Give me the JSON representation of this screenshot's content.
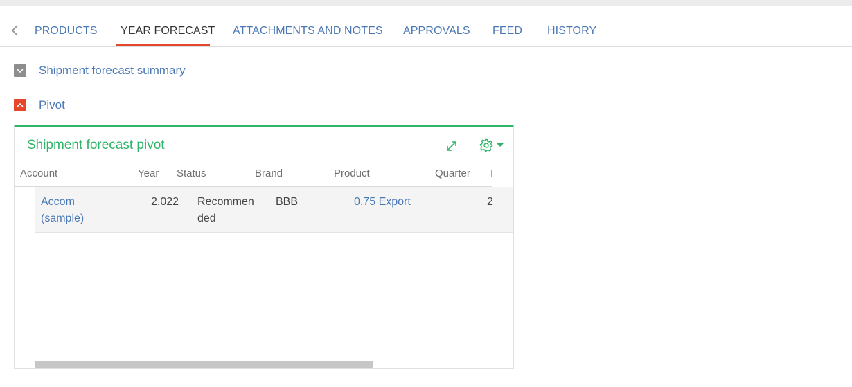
{
  "tabs": {
    "items": [
      {
        "label": "PRODUCTS"
      },
      {
        "label": "YEAR FORECAST"
      },
      {
        "label": "ATTACHMENTS AND NOTES"
      },
      {
        "label": "APPROVALS"
      },
      {
        "label": "FEED"
      },
      {
        "label": "HISTORY"
      }
    ],
    "active": "YEAR FORECAST"
  },
  "sections": {
    "summary": {
      "title": "Shipment forecast summary",
      "state": "collapsed"
    },
    "pivot": {
      "title": "Pivot",
      "state": "expanded"
    }
  },
  "pivot_panel": {
    "title": "Shipment forecast pivot",
    "icons": {
      "expand": "expand-icon",
      "settings": "gear-icon"
    },
    "columns": [
      "Account",
      "Year",
      "Status",
      "Brand",
      "Product",
      "Quarter",
      "I"
    ],
    "row": {
      "account_line1": "Accom",
      "account_line2": "(sample)",
      "year": "2,022",
      "status_line1": "Recommen",
      "status_line2": "ded",
      "brand": "BBB",
      "product": "0.75 Export",
      "quarter": "2"
    }
  },
  "colors": {
    "accent_red": "#e4472a",
    "accent_green": "#2fb56a",
    "link_blue": "#4a78b5"
  }
}
